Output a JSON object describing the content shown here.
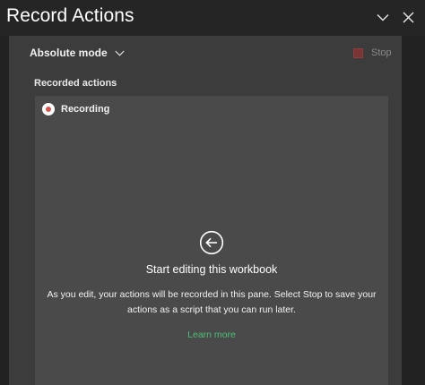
{
  "header": {
    "title": "Record Actions",
    "collapse_icon": "chevron-down-icon",
    "close_icon": "close-icon"
  },
  "toolbar": {
    "mode_label": "Absolute mode",
    "mode_icon": "chevron-down-icon",
    "stop_label": "Stop",
    "stop_icon": "stop-square-icon"
  },
  "actions": {
    "section_label": "Recorded actions",
    "status_label": "Recording",
    "status_icon": "recording-dot-icon"
  },
  "empty_state": {
    "icon": "arrow-left-circle-icon",
    "title": "Start editing this workbook",
    "description": "As you edit, your actions will be recorded in this pane. Select Stop to save your actions as a script that you can run later.",
    "link_label": "Learn more"
  },
  "colors": {
    "background": "#222222",
    "panel": "#3c3c3c",
    "actions_box": "#4a4a4a",
    "link": "#4cbf78",
    "stop_square": "#7a3434",
    "recording_dot": "#d9534f"
  }
}
